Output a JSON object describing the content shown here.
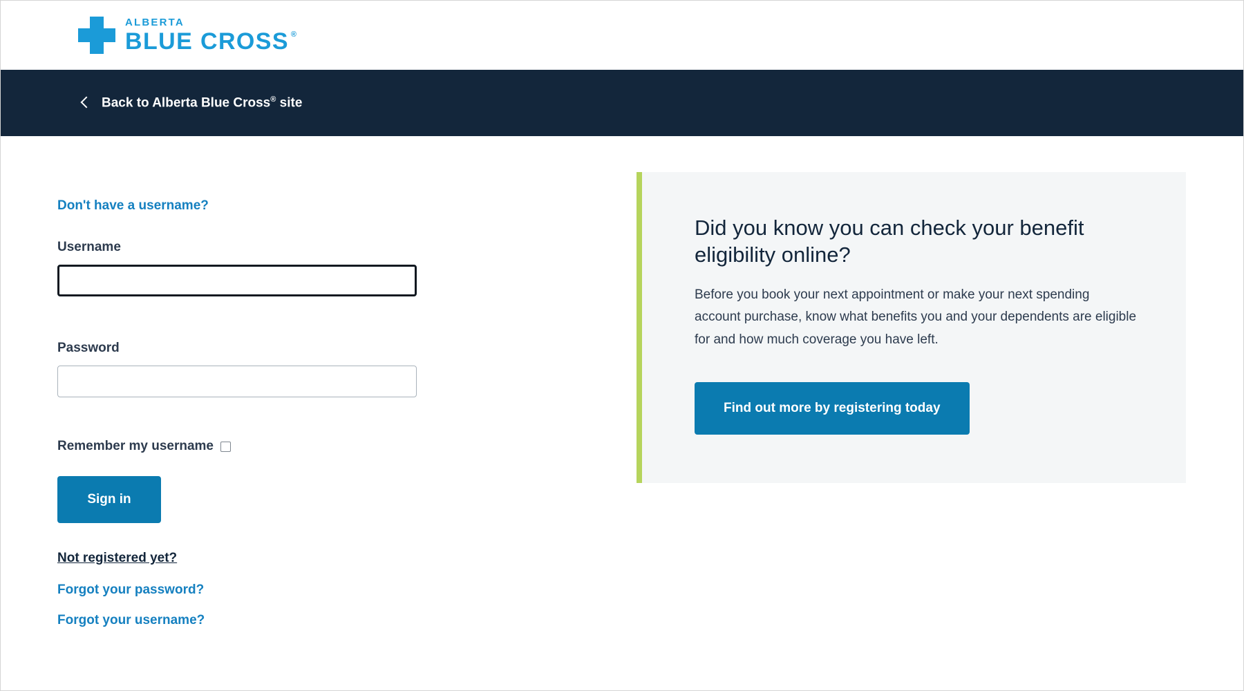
{
  "header": {
    "logo": {
      "cross_icon": "blue-cross-icon",
      "top_word": "ALBERTA",
      "main_word": "BLUE CROSS",
      "registered_mark": "®",
      "brand_color": "#1b9bd8"
    }
  },
  "navbar": {
    "background_color": "#13263b",
    "back_icon": "chevron-left-icon",
    "back_label": "Back to Alberta Blue Cross",
    "back_label_sup": "®",
    "back_label_tail": " site"
  },
  "login": {
    "no_username_link": "Don't have a username?",
    "username_label": "Username",
    "username_value": "",
    "username_placeholder": "",
    "password_label": "Password",
    "password_value": "",
    "password_placeholder": "",
    "remember_label": "Remember my username",
    "remember_checked": false,
    "signin_button": "Sign in",
    "not_registered_link": "Not registered yet?",
    "forgot_password_link": "Forgot your password?",
    "forgot_username_link": "Forgot your username?",
    "link_color": "#1580c0",
    "button_color": "#0b7bb0"
  },
  "promo": {
    "accent_color": "#b6d45c",
    "background_color": "#f4f6f7",
    "title": "Did you know you can check your benefit eligibility online?",
    "body": "Before you book your next appointment or make your next spending account purchase, know what benefits you and your dependents are eligible for and how much coverage you have left.",
    "cta_label": "Find out more by registering today"
  }
}
